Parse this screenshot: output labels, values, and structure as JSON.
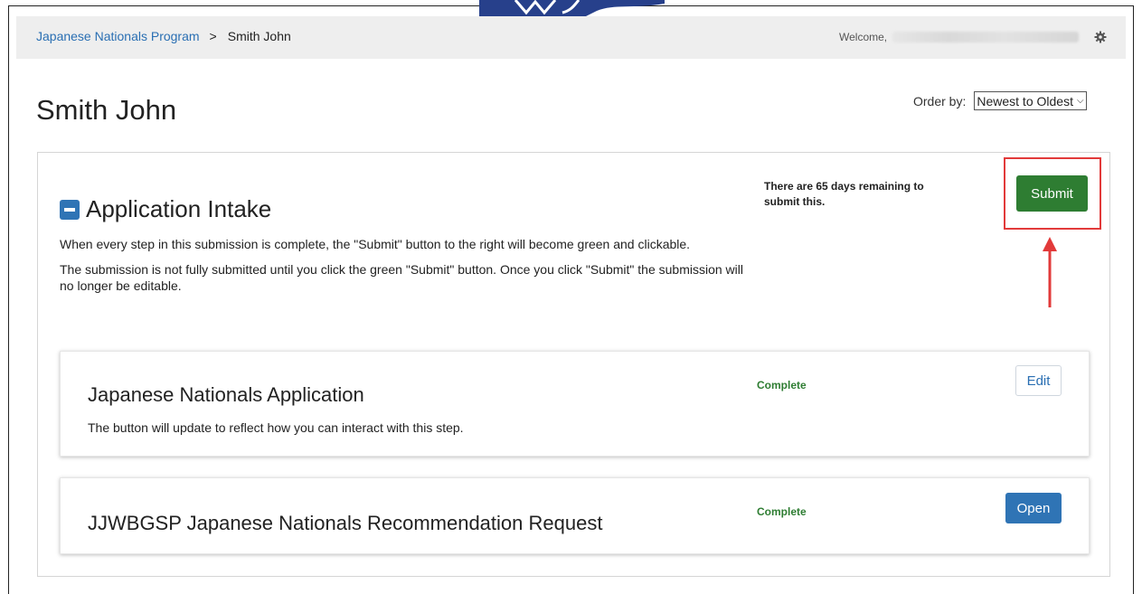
{
  "breadcrumb": {
    "program_link": "Japanese Nationals Program",
    "separator": ">",
    "current": "Smith John"
  },
  "header": {
    "welcome_label": "Welcome,",
    "settings_icon": "gear-icon"
  },
  "page": {
    "title": "Smith John",
    "order_by_label": "Order by:",
    "order_by_value": "Newest to Oldest"
  },
  "intake": {
    "title": "Application Intake",
    "collapse_icon": "minus-square-icon",
    "desc_1": "When every step in this submission is complete, the \"Submit\" button to the right will become green and clickable.",
    "desc_2": "The submission is not fully submitted until you click the green \"Submit\" button. Once you click \"Submit\" the submission will no longer be editable.",
    "remaining": "There are 65 days remaining to submit this.",
    "submit_label": "Submit"
  },
  "steps": [
    {
      "title": "Japanese Nationals Application",
      "description": "The button will update to reflect how you can interact with this step.",
      "status": "Complete",
      "action_label": "Edit"
    },
    {
      "title": "JJWBGSP Japanese Nationals Recommendation Request",
      "status": "Complete",
      "action_label": "Open"
    }
  ],
  "colors": {
    "link_blue": "#2a6fb3",
    "submit_green": "#2e7d32",
    "open_blue": "#2f74b5",
    "highlight_red": "#e23a3a"
  }
}
